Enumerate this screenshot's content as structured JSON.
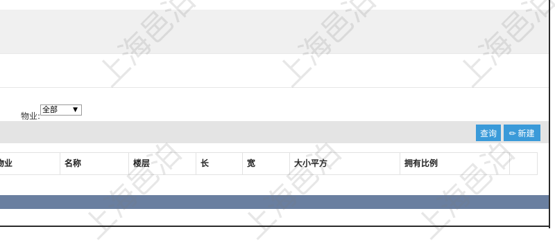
{
  "filter": {
    "property_label": "物业:",
    "property_value": "全部"
  },
  "toolbar": {
    "query_label": "查询",
    "new_label": "新建"
  },
  "table": {
    "columns": [
      "物业",
      "名称",
      "楼层",
      "长",
      "宽",
      "大小平方",
      "拥有比例",
      ""
    ]
  },
  "watermark": "上海邑泊",
  "colors": {
    "button": "#3a9ad9",
    "footer": "#6a7fa0"
  }
}
